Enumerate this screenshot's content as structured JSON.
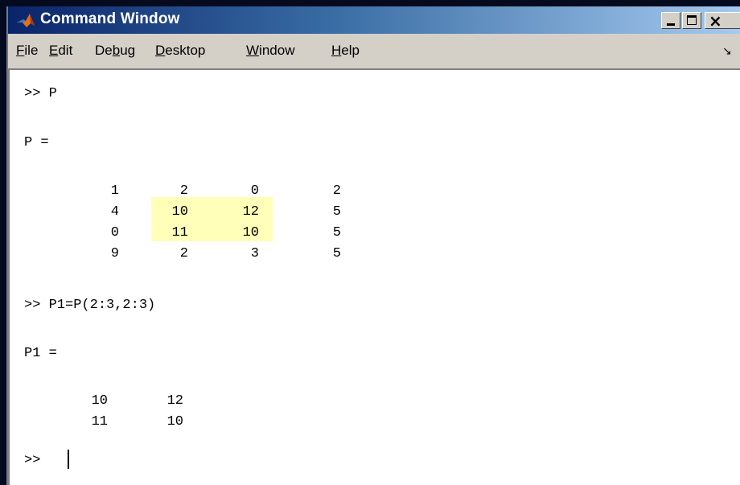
{
  "window": {
    "title": "Command Window",
    "close_glyph": "×"
  },
  "menu": {
    "items": [
      {
        "key": "F",
        "rest": "ile"
      },
      {
        "key": "E",
        "rest": "dit"
      },
      {
        "pre": "De",
        "key": "b",
        "rest": "ug"
      },
      {
        "key": "D",
        "rest": "esktop"
      },
      {
        "key": "W",
        "rest": "indow"
      },
      {
        "key": "H",
        "rest": "elp"
      }
    ],
    "undock_arrow": "↘"
  },
  "console": {
    "cmd1": ">> P",
    "var1": "P =",
    "matrix_p": [
      [
        "1",
        "2",
        "0",
        "2"
      ],
      [
        "4",
        "10",
        "12",
        "5"
      ],
      [
        "0",
        "11",
        "10",
        "5"
      ],
      [
        "9",
        "2",
        "3",
        "5"
      ]
    ],
    "cmd2": ">> P1=P(2:3,2:3)",
    "var2": "P1 =",
    "matrix_p1": [
      [
        "10",
        "12"
      ],
      [
        "11",
        "10"
      ]
    ],
    "prompt": ">>",
    "highlight_color": "#ffffb9"
  }
}
